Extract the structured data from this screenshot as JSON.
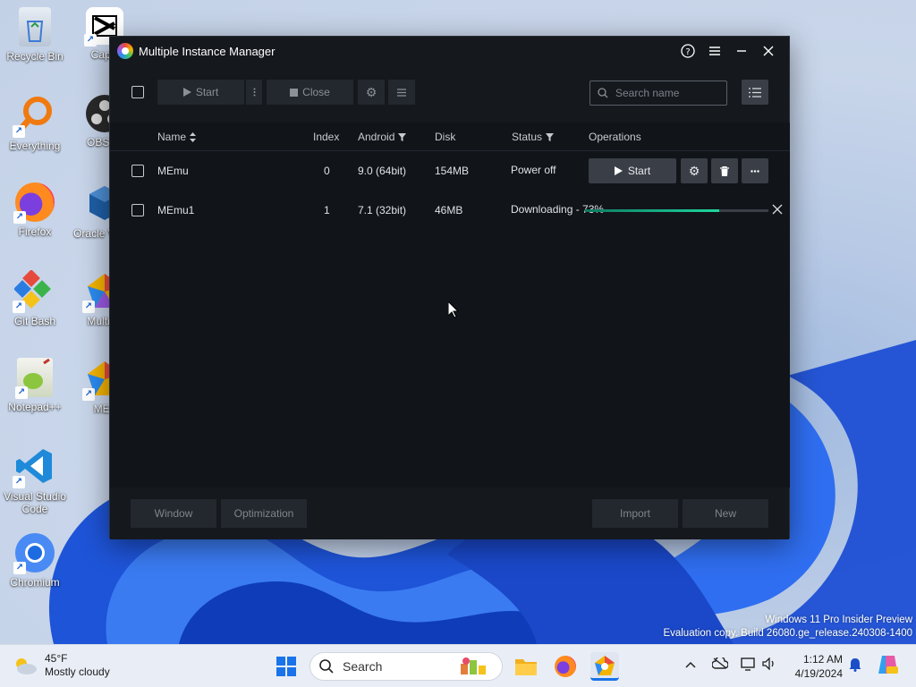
{
  "desktop": {
    "icons": [
      {
        "label": "Recycle Bin"
      },
      {
        "label": "CapC"
      },
      {
        "label": "Everything"
      },
      {
        "label": "OBS St"
      },
      {
        "label": "Firefox"
      },
      {
        "label": "Oracle Virtua"
      },
      {
        "label": "Git Bash"
      },
      {
        "label": "Multi-M"
      },
      {
        "label": "Notepad++"
      },
      {
        "label": "MEn"
      },
      {
        "label": "Visual Studio Code"
      },
      {
        "label": "Chromium"
      }
    ],
    "watermark_line1": "Windows 11 Pro Insider Preview",
    "watermark_line2": "Evaluation copy. Build 26080.ge_release.240308-1400"
  },
  "app": {
    "title": "Multiple Instance Manager",
    "toolbar": {
      "start_label": "Start",
      "close_label": "Close",
      "search_placeholder": "Search name"
    },
    "columns": {
      "name": "Name",
      "index": "Index",
      "android": "Android",
      "disk": "Disk",
      "status": "Status",
      "operations": "Operations"
    },
    "rows": [
      {
        "name": "MEmu",
        "index": "0",
        "android": "9.0 (64bit)",
        "disk": "154MB",
        "status": "Power off",
        "start_label": "Start"
      },
      {
        "name": "MEmu1",
        "index": "1",
        "android": "7.1 (32bit)",
        "disk": "46MB",
        "status": "Downloading - 73%",
        "progress": 0.73
      }
    ],
    "footer": {
      "window": "Window",
      "optimization": "Optimization",
      "import": "Import",
      "new": "New"
    },
    "colors": {
      "accent_progress": "#1fd6a0",
      "window_bg": "#15181d"
    }
  },
  "taskbar": {
    "weather_temp": "45°F",
    "weather_desc": "Mostly cloudy",
    "search_label": "Search",
    "time": "1:12 AM",
    "date": "4/19/2024"
  }
}
